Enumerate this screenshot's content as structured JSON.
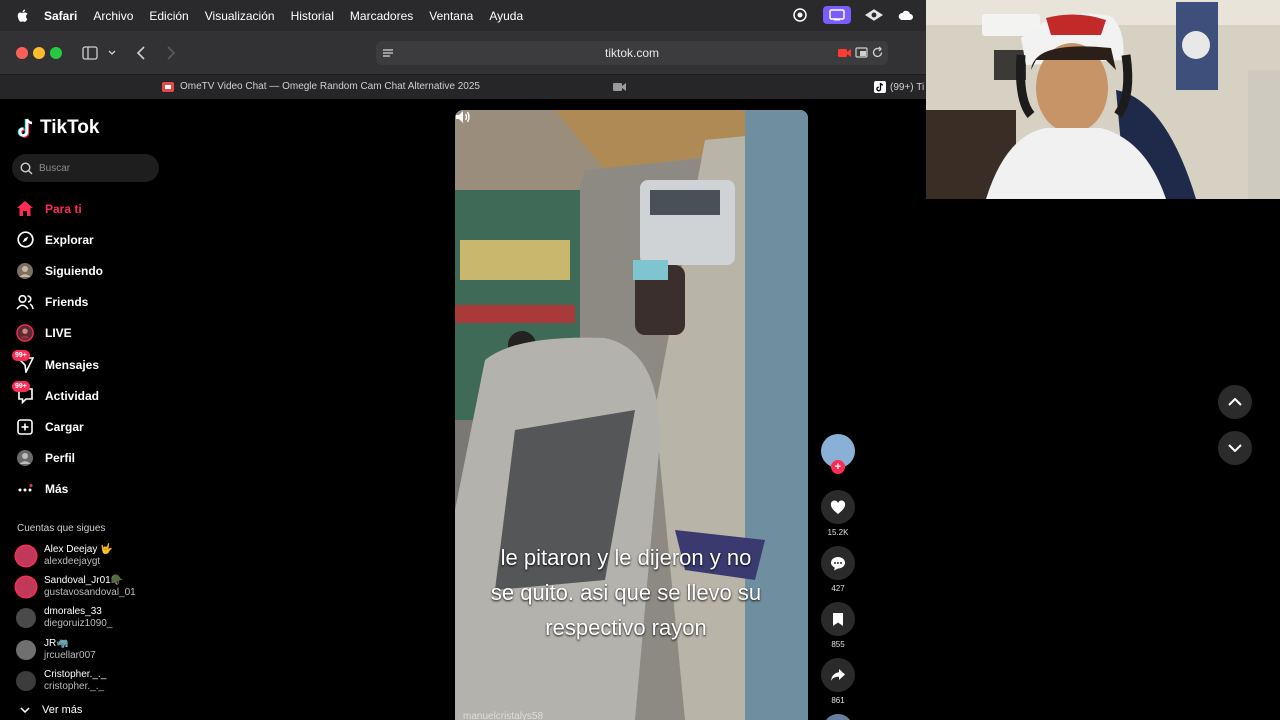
{
  "menubar": {
    "items": [
      "Safari",
      "Archivo",
      "Edición",
      "Visualización",
      "Historial",
      "Marcadores",
      "Ventana",
      "Ayuda"
    ]
  },
  "browser": {
    "address": "tiktok.com",
    "tab1_title": "OmeTV Video Chat — Omegle Random Cam Chat Alternative 2025",
    "tab2_title": "(99+) Ti"
  },
  "tiktok": {
    "logo": "TikTok",
    "search_placeholder": "Buscar",
    "nav": [
      {
        "label": "Para ti",
        "icon": "home-icon"
      },
      {
        "label": "Explorar",
        "icon": "compass-icon"
      },
      {
        "label": "Siguiendo",
        "icon": "following-icon"
      },
      {
        "label": "Friends",
        "icon": "friends-icon"
      },
      {
        "label": "LIVE",
        "icon": "live-icon"
      },
      {
        "label": "Mensajes",
        "icon": "messages-icon",
        "badge": "99+"
      },
      {
        "label": "Actividad",
        "icon": "activity-icon",
        "badge": "99+"
      },
      {
        "label": "Cargar",
        "icon": "upload-icon"
      },
      {
        "label": "Perfil",
        "icon": "profile-icon"
      },
      {
        "label": "Más",
        "icon": "more-icon"
      }
    ],
    "following_title": "Cuentas que sigues",
    "following": [
      {
        "name": "Alex Deejay 🤟",
        "user": "alexdeejaygt",
        "live": true
      },
      {
        "name": "Sandoval_Jr01🪖",
        "user": "gustavosandoval_01",
        "live": true
      },
      {
        "name": "dmorales_33",
        "user": "diegoruiz1090_",
        "live": false
      },
      {
        "name": "JR🦏",
        "user": "jrcuellar007",
        "live": false
      },
      {
        "name": "Cristopher._._",
        "user": "cristopher._._",
        "live": false
      }
    ],
    "see_more": "Ver más"
  },
  "video": {
    "caption_lines": [
      "le pitaron y le dijeron y no",
      "se quito. asi que se llevo su",
      "respectivo rayon"
    ],
    "overlay_user": "manuelcristalys58"
  },
  "actions": {
    "likes": "15.2K",
    "comments": "427",
    "saves": "855",
    "shares": "861"
  },
  "colors": {
    "accent": "#fe2c55",
    "menubar": "#2a2a2c",
    "background": "#000000"
  }
}
